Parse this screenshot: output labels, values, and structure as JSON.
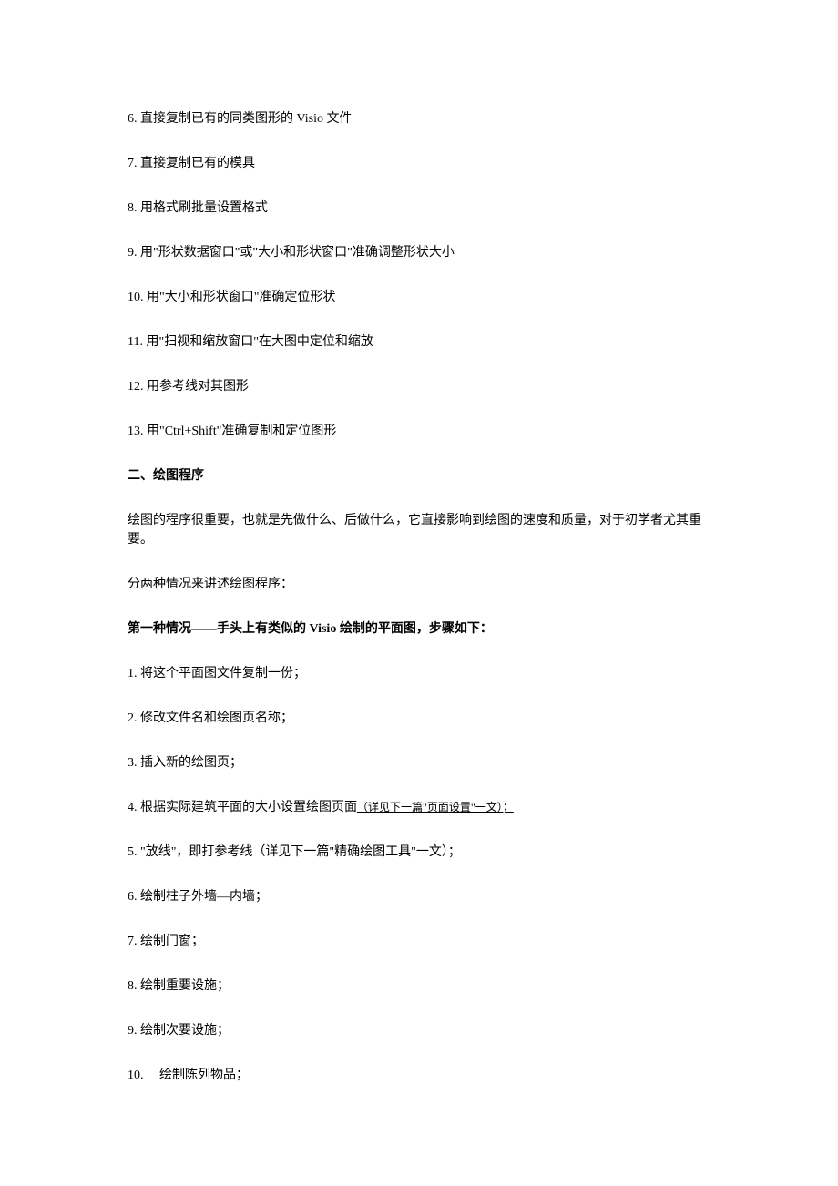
{
  "items1": [
    "6. 直接复制已有的同类图形的 Visio 文件",
    "7. 直接复制已有的模具",
    "8. 用格式刷批量设置格式",
    "9. 用\"形状数据窗口\"或\"大小和形状窗口\"准确调整形状大小",
    "10. 用\"大小和形状窗口\"准确定位形状",
    "11. 用\"扫视和缩放窗口\"在大图中定位和缩放",
    "12. 用参考线对其图形",
    "13. 用\"Ctrl+Shift\"准确复制和定位图形"
  ],
  "heading2": "二、绘图程序",
  "para1": "绘图的程序很重要，也就是先做什么、后做什么，它直接影响到绘图的速度和质量，对于初学者尤其重要。",
  "para2": "分两种情况来讲述绘图程序：",
  "heading3": "第一种情况——手头上有类似的 Visio 绘制的平面图，步骤如下：",
  "steps": [
    "1. 将这个平面图文件复制一份；",
    "2. 修改文件名和绘图页名称；",
    "3. 插入新的绘图页；"
  ],
  "step4_prefix": "4. 根据实际建筑平面的大小设置绘图页面",
  "step4_link": "（详见下一篇\"页面设置\"一文）；",
  "steps_after": [
    "5. \"放线\"，即打参考线（详见下一篇\"精确绘图工具\"一文）；",
    "6. 绘制柱子外墙—内墙；",
    "7. 绘制门窗；",
    "8. 绘制重要设施；",
    "9. 绘制次要设施；",
    "10.　 绘制陈列物品；"
  ]
}
